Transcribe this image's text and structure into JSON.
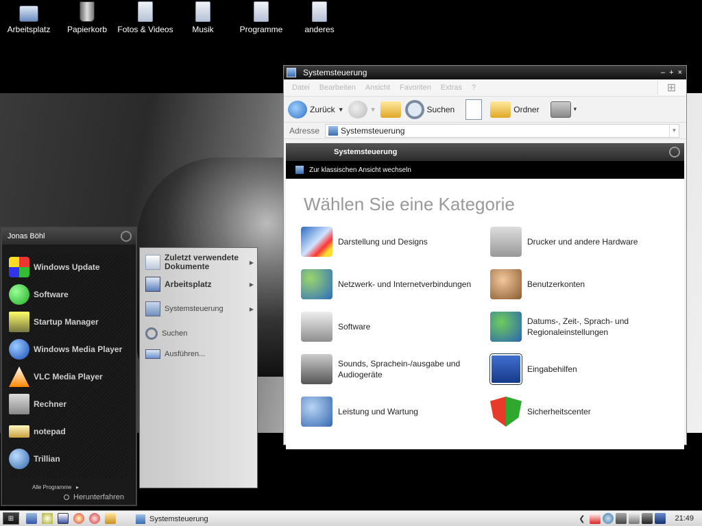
{
  "desktop": {
    "icons": [
      {
        "label": "Arbeitsplatz",
        "icon": "my-computer-icon"
      },
      {
        "label": "Papierkorb",
        "icon": "recycle-bin-icon"
      },
      {
        "label": "Fotos & Videos",
        "icon": "folder-icon"
      },
      {
        "label": "Musik",
        "icon": "music-folder-icon"
      },
      {
        "label": "Programme",
        "icon": "folder-icon"
      },
      {
        "label": "anderes",
        "icon": "folder-icon"
      }
    ]
  },
  "cp_window": {
    "title": "Systemsteuerung",
    "controls": [
      "–",
      "+",
      "×"
    ],
    "menu": [
      "Datei",
      "Bearbeiten",
      "Ansicht",
      "Favoriten",
      "Extras",
      "?"
    ],
    "toolbar": {
      "back": "Zurück",
      "search": "Suchen",
      "folders": "Ordner"
    },
    "address_label": "Adresse",
    "address_value": "Systemsteuerung",
    "panel_header": "Systemsteuerung",
    "switch_view": "Zur klassischen Ansicht wechseln",
    "heading": "Wählen Sie eine Kategorie",
    "categories": [
      {
        "label": "Darstellung und Designs",
        "icon": "display-icon"
      },
      {
        "label": "Drucker und andere Hardware",
        "icon": "printer-icon"
      },
      {
        "label": "Netzwerk- und Internetverbindungen",
        "icon": "network-icon"
      },
      {
        "label": "Benutzerkonten",
        "icon": "users-icon"
      },
      {
        "label": "Software",
        "icon": "software-icon"
      },
      {
        "label": "Datums-, Zeit-, Sprach- und Regionaleinstellungen",
        "icon": "datetime-icon"
      },
      {
        "label": "Sounds, Sprachein-/ausgabe und Audiogeräte",
        "icon": "sounds-icon"
      },
      {
        "label": "Eingabehilfen",
        "icon": "accessibility-icon"
      },
      {
        "label": "Leistung und Wartung",
        "icon": "performance-icon"
      },
      {
        "label": "Sicherheitscenter",
        "icon": "security-shield-icon"
      }
    ]
  },
  "start_menu": {
    "user": "Jonas Böhl",
    "items": [
      {
        "label": "Windows Update",
        "icon": "windows-update-icon"
      },
      {
        "label": "Software",
        "icon": "software-icon"
      },
      {
        "label": "Startup Manager",
        "icon": "startup-manager-icon"
      },
      {
        "label": "Windows Media Player",
        "icon": "media-player-icon"
      },
      {
        "label": "VLC Media Player",
        "icon": "vlc-icon"
      },
      {
        "label": "Rechner",
        "icon": "calculator-icon"
      },
      {
        "label": "notepad",
        "icon": "notepad-icon"
      },
      {
        "label": "Trillian",
        "icon": "trillian-icon"
      }
    ],
    "all_programs": "Alle Programme",
    "shutdown": "Herunterfahren",
    "right": {
      "recent_docs": "Zuletzt verwendete Dokumente",
      "my_computer": "Arbeitsplatz",
      "control_panel": "Systemsteuerung",
      "search": "Suchen",
      "run": "Ausführen..."
    }
  },
  "taskbar": {
    "active_task": "Systemsteuerung",
    "clock": "21:49"
  }
}
